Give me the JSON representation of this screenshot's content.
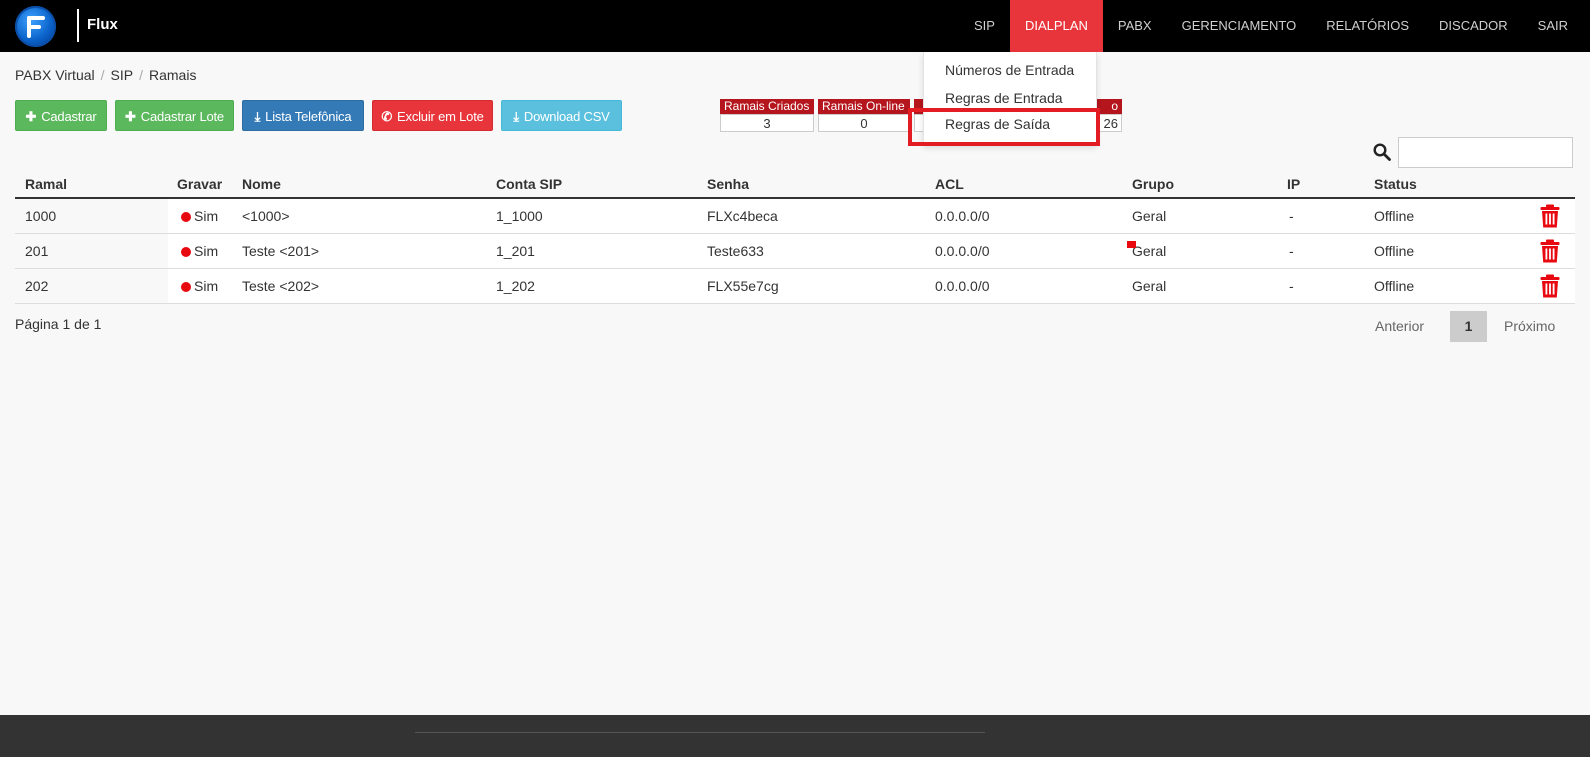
{
  "app": {
    "name": "Flux"
  },
  "nav": {
    "items": [
      {
        "label": "SIP"
      },
      {
        "label": "DIALPLAN",
        "active": true
      },
      {
        "label": "PABX"
      },
      {
        "label": "GERENCIAMENTO"
      },
      {
        "label": "RELATÓRIOS"
      },
      {
        "label": "DISCADOR"
      },
      {
        "label": "SAIR"
      }
    ]
  },
  "dropdown": {
    "items": [
      "Números de Entrada",
      "Regras de Entrada",
      "Regras de Saída"
    ],
    "highlighted": "Regras de Saída"
  },
  "breadcrumb": {
    "items": [
      "PABX Virtual",
      "SIP",
      "Ramais"
    ]
  },
  "toolbar": {
    "cadastrar": "Cadastrar",
    "cadastrar_lote": "Cadastrar Lote",
    "lista_telefonica": "Lista Telefônica",
    "excluir_lote": "Excluir em Lote",
    "download_csv": "Download CSV"
  },
  "stats": [
    {
      "label": "Ramais Criados",
      "value": "3"
    },
    {
      "label": "Ramais On-line",
      "value": "0"
    },
    {
      "label": "",
      "value": ""
    },
    {
      "label": "o",
      "value": "26"
    }
  ],
  "table": {
    "headers": [
      "Ramal",
      "Gravar",
      "Nome",
      "Conta SIP",
      "Senha",
      "ACL",
      "Grupo",
      "IP",
      "Status"
    ],
    "rows": [
      {
        "ramal": "1000",
        "gravar": "Sim",
        "nome": "<1000>",
        "conta": "1_1000",
        "senha": "FLXc4beca",
        "acl": "0.0.0.0/0",
        "grupo": "Geral",
        "ip": "-",
        "status": "Offline"
      },
      {
        "ramal": "201",
        "gravar": "Sim",
        "nome": "Teste <201>",
        "conta": "1_201",
        "senha": "Teste633",
        "acl": "0.0.0.0/0",
        "grupo": "Geral",
        "ip": "-",
        "status": "Offline"
      },
      {
        "ramal": "202",
        "gravar": "Sim",
        "nome": "Teste <202>",
        "conta": "1_202",
        "senha": "FLX55e7cg",
        "acl": "0.0.0.0/0",
        "grupo": "Geral",
        "ip": "-",
        "status": "Offline"
      }
    ]
  },
  "pagination": {
    "info": "Página 1 de 1",
    "prev": "Anterior",
    "current": "1",
    "next": "Próximo"
  },
  "colors": {
    "accent": "#e8353b",
    "topbar": "#000000",
    "footer": "#333333"
  }
}
